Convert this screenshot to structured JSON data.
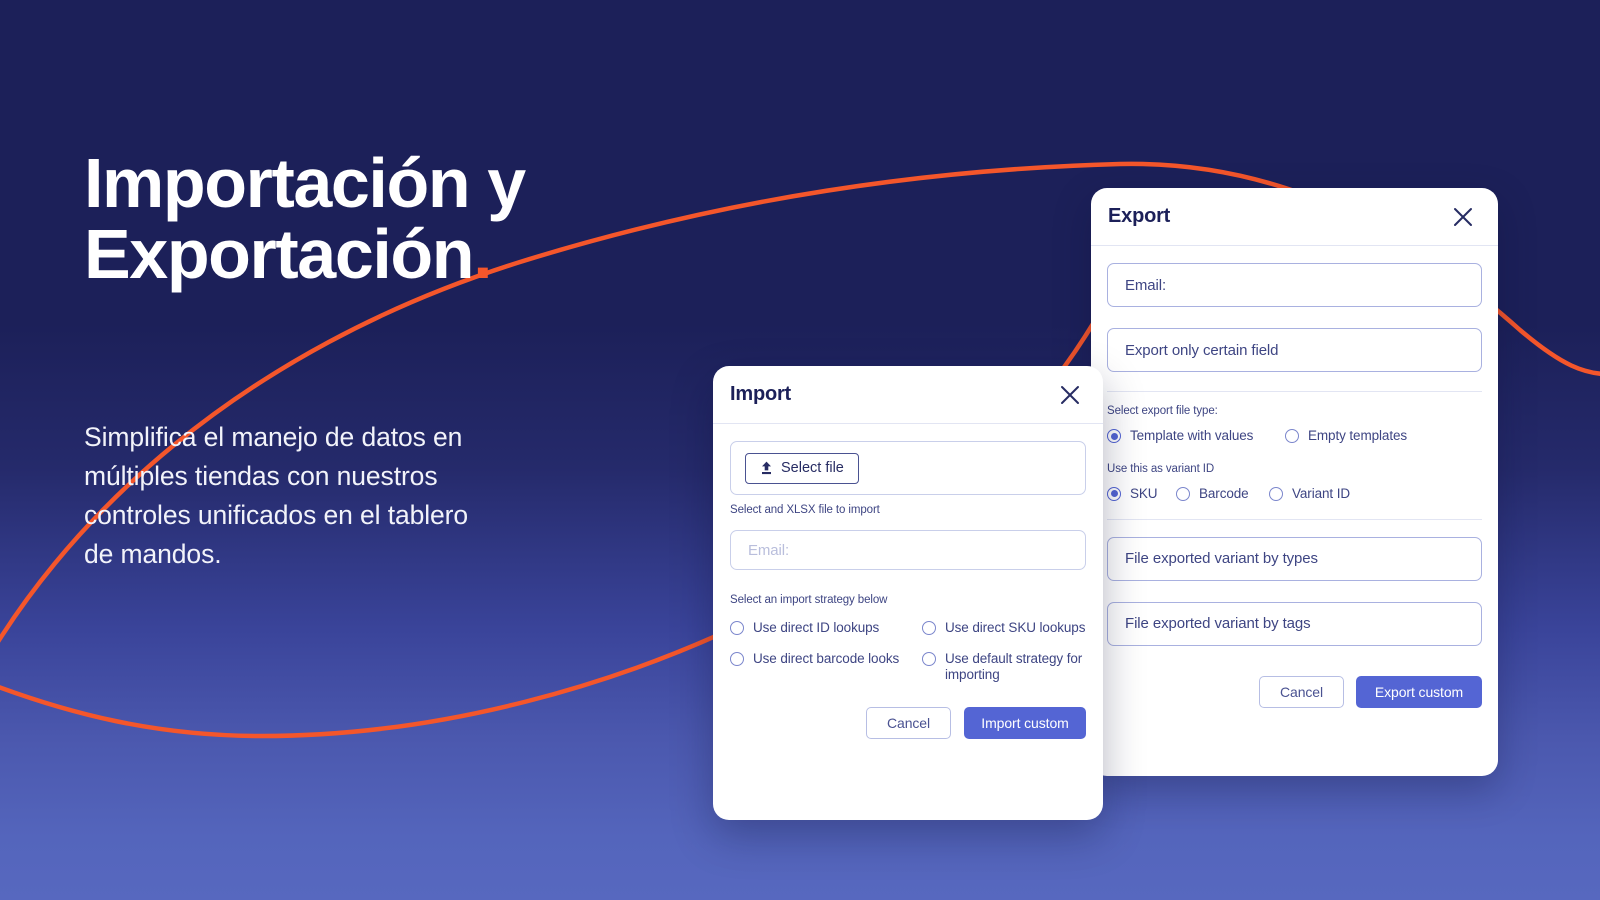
{
  "theme": {
    "bg_top": "#1C2059",
    "bg_bottom": "#5465BC",
    "accent_orange": "#F4562B",
    "accent_indigo": "#5465D4",
    "text_navy": "#1C2059"
  },
  "hero": {
    "title": "Importación y\nExportación",
    "title_dot": ".",
    "body": "Simplifica el manejo de datos en\nmúltiples tiendas con nuestros\ncontroles unificados en el tablero\nde mandos."
  },
  "import_dialog": {
    "title": "Import",
    "close_icon": "close-icon",
    "select_file_button": "Select file",
    "upload_icon": "upload-icon",
    "file_helper": "Select and XLSX file to import",
    "email_placeholder": "Email:",
    "email_value": "",
    "strategy_label": "Select an import strategy below",
    "strategies": [
      {
        "label": "Use direct ID lookups",
        "checked": false
      },
      {
        "label": "Use direct SKU lookups",
        "checked": false
      },
      {
        "label": "Use direct barcode looks",
        "checked": false
      },
      {
        "label": "Use default strategy for importing",
        "checked": false
      }
    ],
    "cancel_label": "Cancel",
    "submit_label": "Import custom"
  },
  "export_dialog": {
    "title": "Export",
    "close_icon": "close-icon",
    "email_value": "Email:",
    "certain_field_value": "Export only certain field",
    "filetype_label": "Select export file type:",
    "filetypes": [
      {
        "label": "Template with values",
        "checked": true
      },
      {
        "label": "Empty templates",
        "checked": false
      }
    ],
    "variant_label": "Use this as variant ID",
    "variants": [
      {
        "label": "SKU",
        "checked": true
      },
      {
        "label": "Barcode",
        "checked": false
      },
      {
        "label": "Variant ID",
        "checked": false
      }
    ],
    "variant_by_types_value": "File exported variant by types",
    "variant_by_tags_value": "File exported variant by tags",
    "cancel_label": "Cancel",
    "submit_label": "Export custom"
  }
}
